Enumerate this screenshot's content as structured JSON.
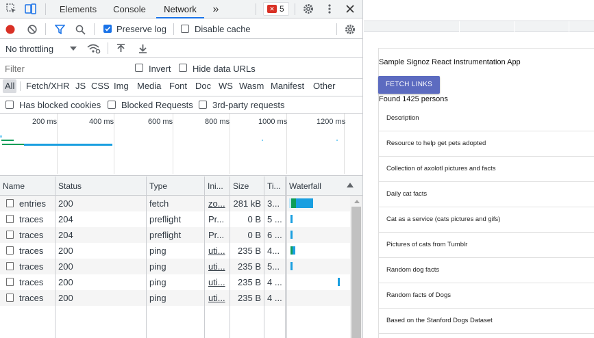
{
  "devtools": {
    "tabs": [
      "Elements",
      "Console",
      "Network"
    ],
    "active_tab": "Network",
    "more_tabs_glyph": "»",
    "error_badge_count": "5",
    "toolbar": {
      "preserve_log": "Preserve log",
      "preserve_log_checked": true,
      "disable_cache": "Disable cache",
      "disable_cache_checked": false,
      "throttling": "No throttling"
    },
    "filter": {
      "placeholder": "Filter",
      "invert": "Invert",
      "hide_data_urls": "Hide data URLs"
    },
    "types": [
      "All",
      "Fetch/XHR",
      "JS",
      "CSS",
      "Img",
      "Media",
      "Font",
      "Doc",
      "WS",
      "Wasm",
      "Manifest",
      "Other"
    ],
    "active_type": "All",
    "blocked": {
      "has_blocked_cookies": "Has blocked cookies",
      "blocked_requests": "Blocked Requests",
      "third_party": "3rd-party requests"
    },
    "timeline_ticks": [
      "200 ms",
      "400 ms",
      "600 ms",
      "800 ms",
      "1000 ms",
      "1200 ms"
    ],
    "columns": [
      "Name",
      "Status",
      "Type",
      "Ini...",
      "Size",
      "Ti...",
      "Waterfall"
    ],
    "rows": [
      {
        "name": "entries",
        "status": "200",
        "type": "fetch",
        "initiator": "zo...",
        "initiator_link": true,
        "size": "281 kB",
        "time": "3..."
      },
      {
        "name": "traces",
        "status": "204",
        "type": "preflight",
        "initiator": "Pr...",
        "initiator_link": false,
        "size": "0 B",
        "time": "5 ..."
      },
      {
        "name": "traces",
        "status": "204",
        "type": "preflight",
        "initiator": "Pr...",
        "initiator_link": false,
        "size": "0 B",
        "time": "6 ..."
      },
      {
        "name": "traces",
        "status": "200",
        "type": "ping",
        "initiator": "uti...",
        "initiator_link": true,
        "size": "235 B",
        "time": "4..."
      },
      {
        "name": "traces",
        "status": "200",
        "type": "ping",
        "initiator": "uti...",
        "initiator_link": true,
        "size": "235 B",
        "time": "5..."
      },
      {
        "name": "traces",
        "status": "200",
        "type": "ping",
        "initiator": "uti...",
        "initiator_link": true,
        "size": "235 B",
        "time": "4 ..."
      },
      {
        "name": "traces",
        "status": "200",
        "type": "ping",
        "initiator": "uti...",
        "initiator_link": true,
        "size": "235 B",
        "time": "4 ..."
      }
    ],
    "colors": {
      "accent": "#1a73e8",
      "record": "#d93025",
      "waterfall_blue": "#1a9fe0",
      "waterfall_green": "#0f9d58"
    }
  },
  "app": {
    "title": "Sample Signoz React Instrumentation App",
    "fetch_button": "FETCH LINKS",
    "found": "Found 1425 persons",
    "items": [
      "Description",
      "Resource to help get pets adopted",
      "Collection of axolotl pictures and facts",
      "Daily cat facts",
      "Cat as a service (cats pictures and gifs)",
      "Pictures of cats from Tumblr",
      "Random dog facts",
      "Random facts of Dogs",
      "Based on the Stanford Dogs Dataset"
    ]
  }
}
